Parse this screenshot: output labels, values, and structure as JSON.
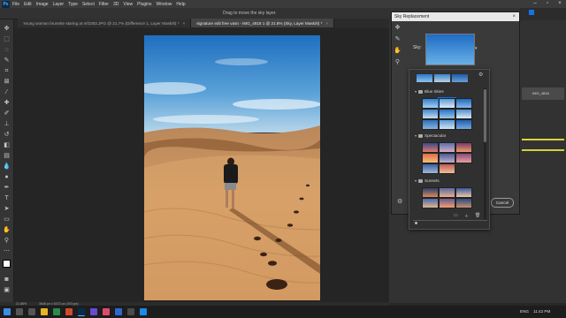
{
  "menubar": {
    "app_icon": "Ps",
    "items": [
      "File",
      "Edit",
      "Image",
      "Layer",
      "Type",
      "Select",
      "Filter",
      "3D",
      "View",
      "Plugins",
      "Window",
      "Help"
    ]
  },
  "options_bar": {
    "hint": "Drag to move the sky layer."
  },
  "tabs": [
    {
      "label": "Young woman brunette staring at mf1003.JPG @ 21.7% (Difference 1, Layer Mask/8) *"
    },
    {
      "label": "signature edit free vasn - IMG_4818 1 @ 21.8% (Sky, Layer Mask/8) *",
      "active": true
    }
  ],
  "sky_dialog": {
    "title": "Sky Replacement",
    "sky_label": "Sky:",
    "cancel_label": "Cancel"
  },
  "sky_popup": {
    "groups": [
      {
        "name": "Blue Skies"
      },
      {
        "name": "Spectacular"
      },
      {
        "name": "Sunsets"
      }
    ]
  },
  "panels": {
    "layer_label": "IMG_4818"
  },
  "status": {
    "zoom": "21.88%",
    "doc": "3648 px x 5472 px (300 ppi)"
  },
  "taskbar": {
    "lang": "ENG",
    "time": "11:42 PM"
  },
  "colors": {
    "accent": "#1473e6",
    "panel_bg": "#323232",
    "dialog_bg": "#3a3a3a"
  }
}
